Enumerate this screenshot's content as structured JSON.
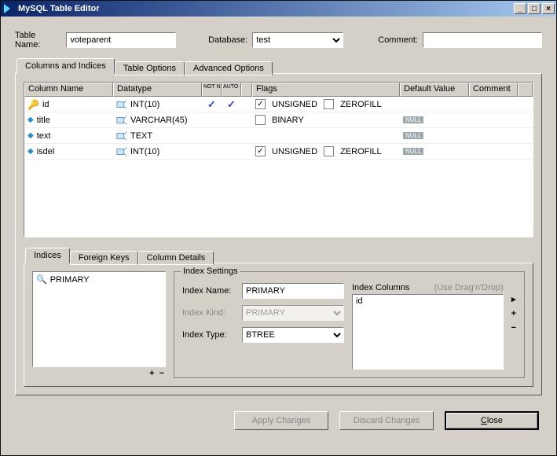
{
  "window": {
    "title": "MySQL Table Editor"
  },
  "header": {
    "table_name_label": "Table Name:",
    "table_name_value": "voteparent",
    "database_label": "Database:",
    "database_value": "test",
    "comment_label": "Comment:",
    "comment_value": ""
  },
  "main_tabs": [
    "Columns and Indices",
    "Table Options",
    "Advanced Options"
  ],
  "main_tabs_active": 0,
  "grid": {
    "headers": {
      "column_name": "Column Name",
      "datatype": "Datatype",
      "not_null": "NOT NULL",
      "auto_inc": "AUTO INC",
      "flags": "Flags",
      "default_value": "Default Value",
      "comment": "Comment"
    },
    "rows": [
      {
        "pk": true,
        "name": "id",
        "datatype": "INT(10)",
        "not_null": true,
        "auto_inc": true,
        "flags": {
          "unsigned": true,
          "zerofill": false,
          "binary": null
        },
        "default_null": false
      },
      {
        "pk": false,
        "name": "title",
        "datatype": "VARCHAR(45)",
        "not_null": false,
        "auto_inc": false,
        "flags": {
          "unsigned": null,
          "zerofill": null,
          "binary": false
        },
        "default_null": true
      },
      {
        "pk": false,
        "name": "text",
        "datatype": "TEXT",
        "not_null": false,
        "auto_inc": false,
        "flags": {
          "unsigned": null,
          "zerofill": null,
          "binary": null
        },
        "default_null": true
      },
      {
        "pk": false,
        "name": "isdel",
        "datatype": "INT(10)",
        "not_null": false,
        "auto_inc": false,
        "flags": {
          "unsigned": true,
          "zerofill": false,
          "binary": null
        },
        "default_null": true
      }
    ],
    "flag_labels": {
      "unsigned": "UNSIGNED",
      "zerofill": "ZEROFILL",
      "binary": "BINARY"
    },
    "null_badge": "NULL"
  },
  "bottom_tabs": [
    "Indices",
    "Foreign Keys",
    "Column Details"
  ],
  "bottom_tabs_active": 0,
  "indices": {
    "list": [
      "PRIMARY"
    ],
    "settings_caption": "Index Settings",
    "index_name_label": "Index Name:",
    "index_name_value": "PRIMARY",
    "index_kind_label": "Index Kind:",
    "index_kind_value": "PRIMARY",
    "index_type_label": "Index Type:",
    "index_type_value": "BTREE",
    "index_columns_label": "Index Columns",
    "dragdrop_hint": "(Use Drag'n'Drop)",
    "index_columns": [
      "id"
    ]
  },
  "footer": {
    "apply": "Apply Changes",
    "discard": "Discard Changes",
    "close": "Close"
  }
}
